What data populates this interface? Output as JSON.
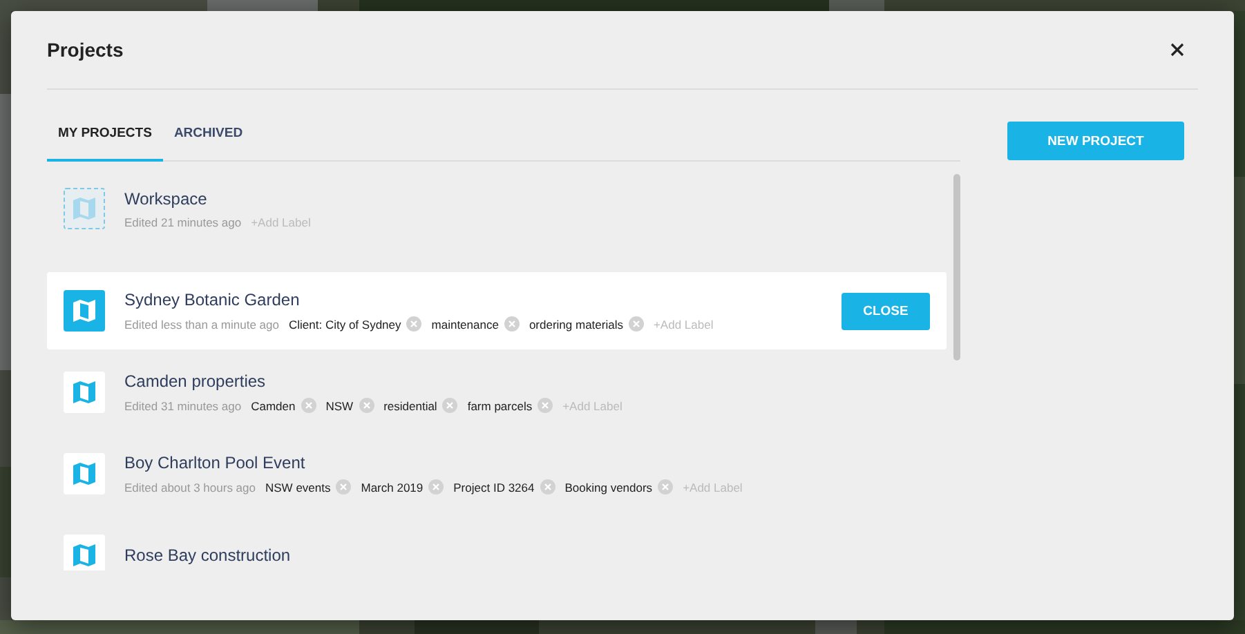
{
  "dialog": {
    "title": "Projects"
  },
  "tabs": [
    {
      "label": "MY PROJECTS",
      "selected": true
    },
    {
      "label": "ARCHIVED",
      "selected": false
    }
  ],
  "new_project_button": "NEW PROJECT",
  "projects": [
    {
      "kind": "workspace",
      "name": "Workspace",
      "edited": "Edited 21 minutes ago",
      "add_label": "+Add Label",
      "selected": false
    },
    {
      "kind": "project",
      "name": "Sydney Botanic Garden",
      "edited": "Edited less than a minute ago",
      "labels": [
        "Client: City of Sydney",
        "maintenance",
        "ordering materials"
      ],
      "add_label": "+Add Label",
      "selected": true,
      "close_button": "CLOSE"
    },
    {
      "kind": "project",
      "name": "Camden properties",
      "edited": "Edited 31 minutes ago",
      "labels": [
        "Camden",
        "NSW",
        "residential",
        "farm parcels"
      ],
      "add_label": "+Add Label",
      "selected": false
    },
    {
      "kind": "project",
      "name": "Boy Charlton Pool Event",
      "edited": "Edited about 3 hours ago",
      "labels": [
        "NSW events",
        "March 2019",
        "Project ID 3264",
        "Booking vendors"
      ],
      "add_label": "+Add Label",
      "selected": false
    },
    {
      "kind": "project",
      "name": "Rose Bay construction",
      "selected": false
    }
  ]
}
